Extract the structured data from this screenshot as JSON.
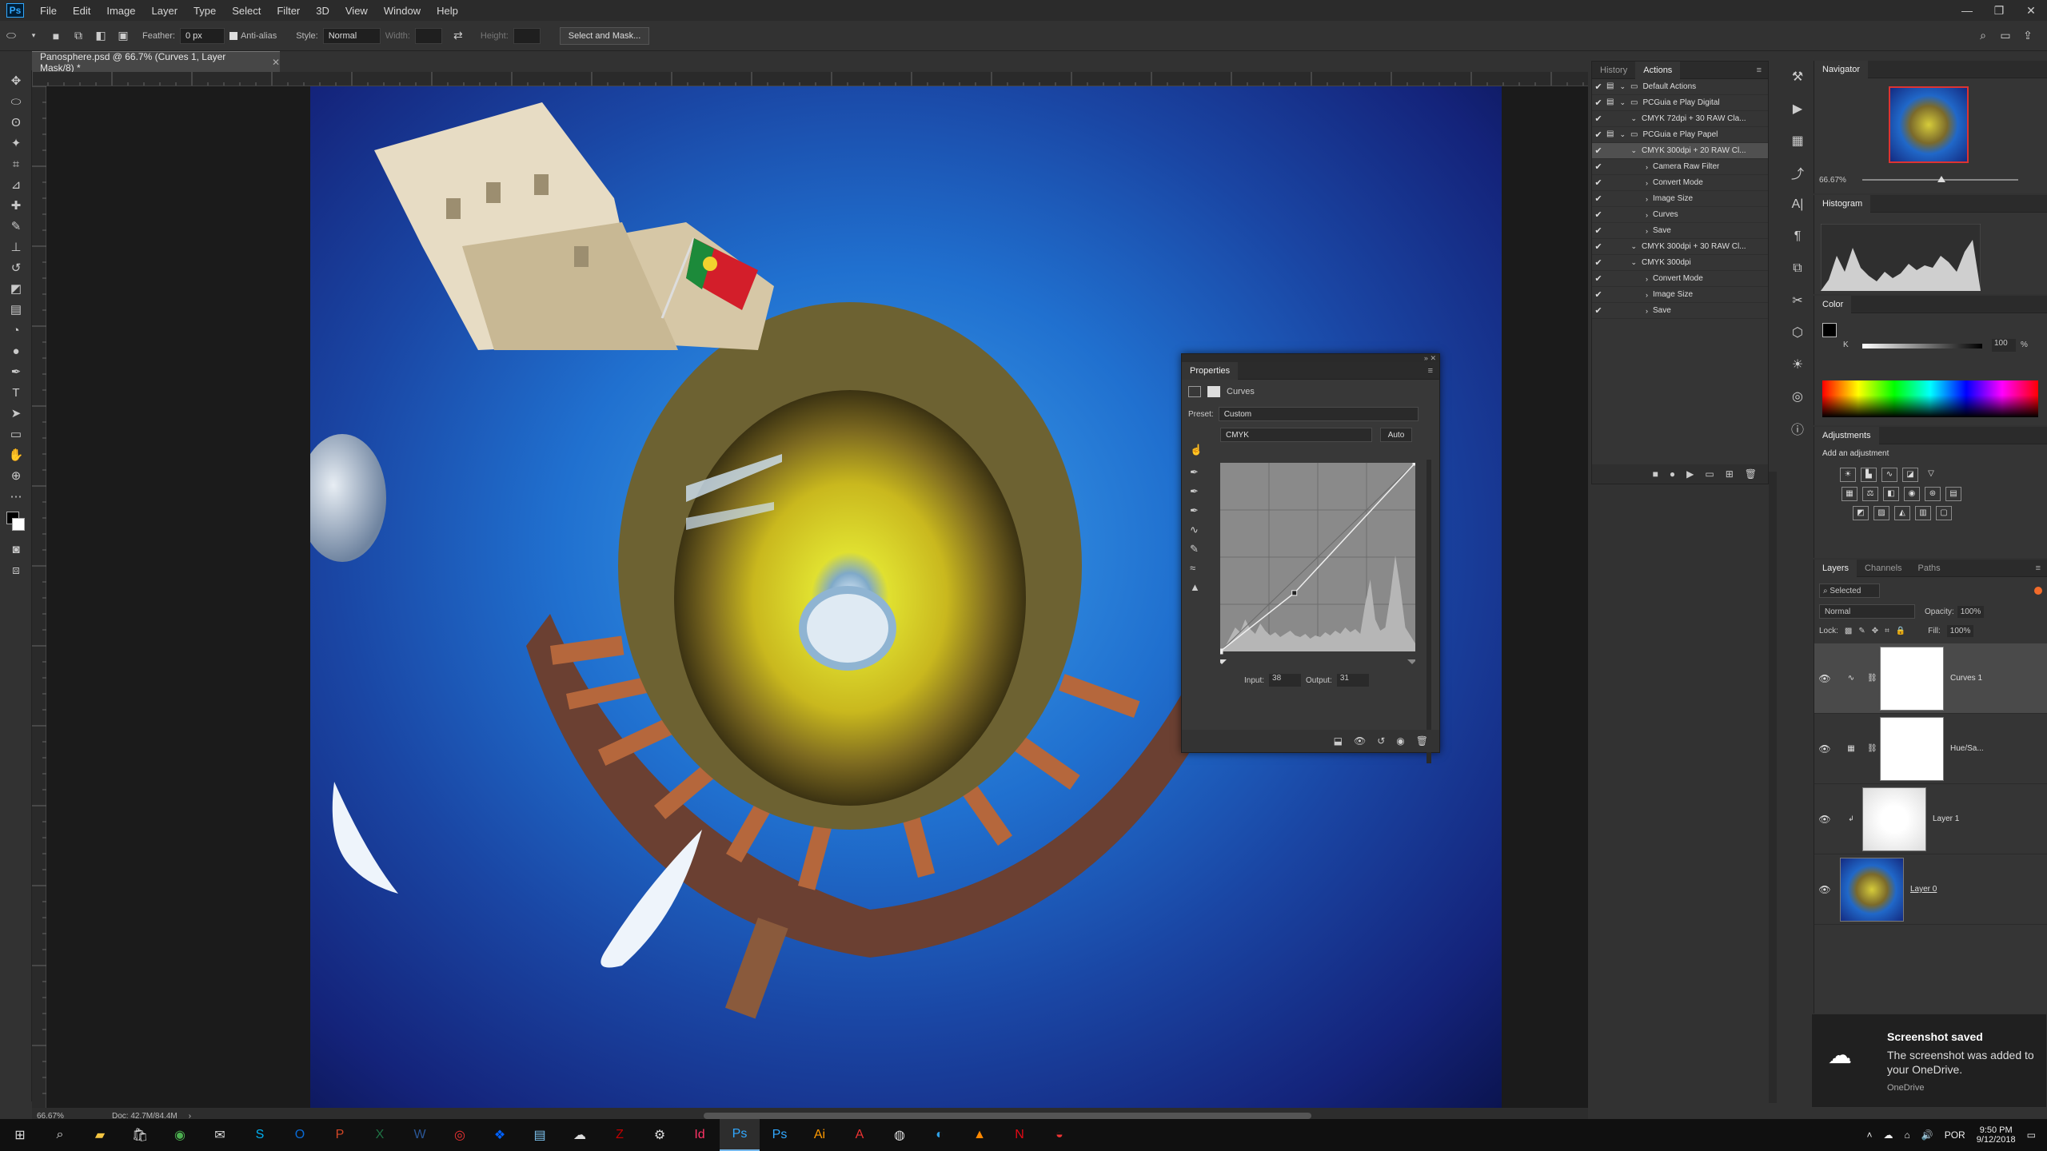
{
  "menubar": {
    "logo": "Ps",
    "items": [
      "File",
      "Edit",
      "Image",
      "Layer",
      "Type",
      "Select",
      "Filter",
      "3D",
      "View",
      "Window",
      "Help"
    ]
  },
  "options": {
    "feather_label": "Feather:",
    "feather_value": "0 px",
    "antialias_label": "Anti-alias",
    "style_label": "Style:",
    "style_value": "Normal",
    "width_label": "Width:",
    "height_label": "Height:",
    "select_mask": "Select and Mask..."
  },
  "document": {
    "tab_title": "Panosphere.psd @ 66.7% (Curves 1, Layer Mask/8) *",
    "zoom": "66.67%",
    "doc_info": "Doc: 42.7M/84.4M"
  },
  "actions_panel": {
    "tabs": [
      "History",
      "Actions"
    ],
    "rows": [
      {
        "label": "Default Actions",
        "level": 0,
        "folder": true
      },
      {
        "label": "PCGuia e Play Digital",
        "level": 0,
        "folder": true
      },
      {
        "label": "CMYK 72dpi + 30 RAW Cla...",
        "level": 1
      },
      {
        "label": "PCGuia e Play Papel",
        "level": 0,
        "folder": true
      },
      {
        "label": "CMYK 300dpi + 20 RAW Cl...",
        "level": 1,
        "selected": true
      },
      {
        "label": "Camera Raw Filter",
        "level": 2
      },
      {
        "label": "Convert Mode",
        "level": 2
      },
      {
        "label": "Image Size",
        "level": 2
      },
      {
        "label": "Curves",
        "level": 2
      },
      {
        "label": "Save",
        "level": 2
      },
      {
        "label": "CMYK 300dpi + 30 RAW Cl...",
        "level": 1
      },
      {
        "label": "CMYK 300dpi",
        "level": 1
      },
      {
        "label": "Convert Mode",
        "level": 2
      },
      {
        "label": "Image Size",
        "level": 2
      },
      {
        "label": "Save",
        "level": 2
      }
    ]
  },
  "properties": {
    "title": "Properties",
    "type": "Curves",
    "preset_label": "Preset:",
    "preset_value": "Custom",
    "channel": "CMYK",
    "auto": "Auto",
    "input_label": "Input:",
    "input_value": "38",
    "output_label": "Output:",
    "output_value": "31"
  },
  "navigator": {
    "title": "Navigator",
    "zoom": "66.67%"
  },
  "histogram": {
    "title": "Histogram"
  },
  "color": {
    "title": "Color",
    "channel": "K",
    "value": "100",
    "unit": "%"
  },
  "adjustments": {
    "title": "Adjustments",
    "subtitle": "Add an adjustment"
  },
  "layers_panel": {
    "tabs": [
      "Layers",
      "Channels",
      "Paths"
    ],
    "filter": "Selected",
    "blend": "Normal",
    "opacity_label": "Opacity:",
    "opacity": "100%",
    "lock_label": "Lock:",
    "fill_label": "Fill:",
    "fill": "100%",
    "layers": [
      {
        "name": "Curves 1",
        "selected": true
      },
      {
        "name": "Hue/Sa..."
      },
      {
        "name": "Layer 1"
      },
      {
        "name": "Layer 0"
      }
    ]
  },
  "toast": {
    "title": "Screenshot saved",
    "body": "The screenshot was added to your OneDrive.",
    "source": "OneDrive"
  },
  "taskbar": {
    "lang": "POR",
    "time": "9:50 PM",
    "date": "9/12/2018"
  },
  "colors": {
    "accent": "#31a8ff",
    "ps_bg": "#323232",
    "taskbar": "#101010"
  },
  "curve_points": [
    [
      0,
      0
    ],
    [
      38,
      31
    ],
    [
      100,
      100
    ]
  ]
}
